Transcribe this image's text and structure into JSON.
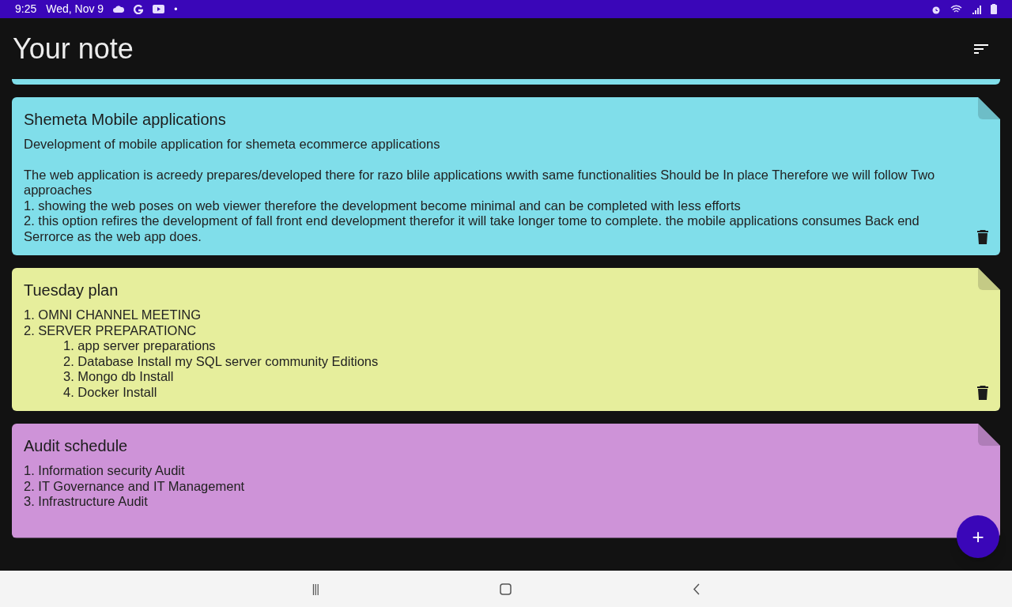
{
  "status_bar": {
    "time": "9:25",
    "date": "Wed, Nov 9",
    "dot": "•"
  },
  "app_bar": {
    "title": "Your note"
  },
  "notes": [
    {
      "title": "Shemeta Mobile applications",
      "color": "#80deea",
      "blocks": [
        {
          "lines": [
            {
              "text": "Development of mobile application for shemeta ecommerce applications"
            }
          ]
        },
        {
          "lines": [
            {
              "text": "The web application is acreedy prepares/developed there for razo blile applications wwith same functionalities Should be In place Therefore we will follow Two approaches"
            },
            {
              "text": "1. showing the web poses on web viewer therefore the development become minimal and can be completed with less efforts"
            },
            {
              "text": "2. this option refires the development of fall front end development therefor it will take longer tome to complete. the mobile applications consumes Back end Serrorce as the web app does."
            }
          ]
        }
      ]
    },
    {
      "title": "Tuesday plan",
      "color": "#e6ee9c",
      "blocks": [
        {
          "lines": [
            {
              "text": "1. OMNI CHANNEL MEETING"
            },
            {
              "text": "2. SERVER PREPARATIONC",
              "children": [
                {
                  "text": "1. app server preparations"
                },
                {
                  "text": "2. Database Install my SQL server community Editions"
                },
                {
                  "text": "3. Mongo db Install"
                },
                {
                  "text": "4. Docker Install"
                }
              ]
            }
          ]
        }
      ]
    },
    {
      "title": "Audit schedule",
      "color": "#ce93d8",
      "blocks": [
        {
          "lines": [
            {
              "text": "1. Information security Audit"
            },
            {
              "text": "2. IT Governance and IT Management"
            },
            {
              "text": "3. Infrastructure Audit"
            }
          ]
        }
      ]
    }
  ],
  "fab": {
    "symbol": "+"
  },
  "nav_bar": {
    "recents": "|||"
  }
}
